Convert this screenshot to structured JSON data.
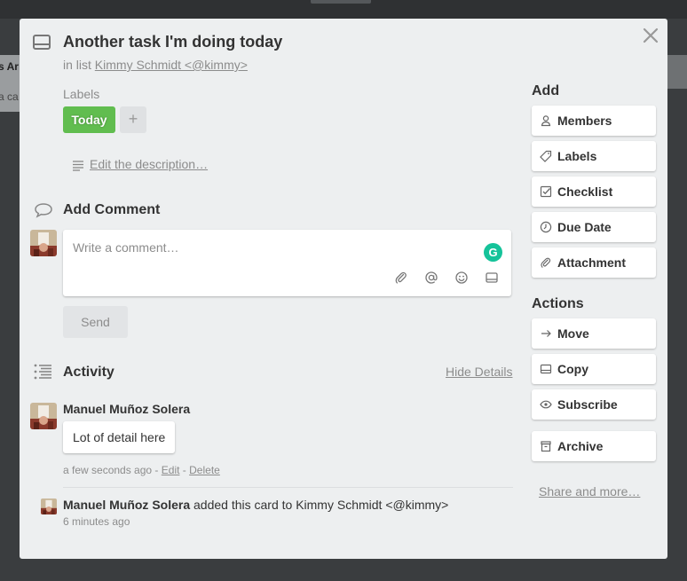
{
  "background": {
    "list_title_fragment": "s Ar",
    "card_fragment": "a ca"
  },
  "card": {
    "title": "Another task I'm doing today",
    "in_list_prefix": "in list",
    "list_name": "Kimmy Schmidt <@kimmy>"
  },
  "labels": {
    "heading": "Labels",
    "items": [
      {
        "name": "Today",
        "color": "#61bd4f"
      }
    ],
    "add_symbol": "+"
  },
  "description": {
    "edit_link": "Edit the description…"
  },
  "comment": {
    "heading": "Add Comment",
    "placeholder": "Write a comment…",
    "send_label": "Send",
    "grammarly_letter": "G",
    "tools": [
      "attachment-icon",
      "mention-icon",
      "emoji-icon",
      "card-icon"
    ]
  },
  "activity": {
    "heading": "Activity",
    "hide_details": "Hide Details",
    "entries": [
      {
        "author": "Manuel Muñoz Solera",
        "comment": "Lot of detail here",
        "time": "a few seconds ago",
        "sep1": "-",
        "edit": "Edit",
        "sep2": "-",
        "delete": "Delete"
      },
      {
        "author": "Manuel Muñoz Solera",
        "action": "added this card to Kimmy Schmidt <@kimmy>",
        "time": "6 minutes ago"
      }
    ]
  },
  "sidebar": {
    "add_heading": "Add",
    "add_buttons": [
      {
        "label": "Members",
        "icon": "person-icon"
      },
      {
        "label": "Labels",
        "icon": "tag-icon"
      },
      {
        "label": "Checklist",
        "icon": "checkbox-icon"
      },
      {
        "label": "Due Date",
        "icon": "clock-icon"
      },
      {
        "label": "Attachment",
        "icon": "paperclip-icon"
      }
    ],
    "actions_heading": "Actions",
    "action_buttons": [
      {
        "label": "Move",
        "icon": "arrow-right-icon"
      },
      {
        "label": "Copy",
        "icon": "card-icon"
      },
      {
        "label": "Subscribe",
        "icon": "eye-icon"
      },
      {
        "label": "Archive",
        "icon": "archive-icon"
      }
    ],
    "share_link": "Share and more…"
  },
  "colors": {
    "modal_bg": "#edeff0",
    "label_green": "#61bd4f",
    "muted_text": "#8c8c8c",
    "grammarly_green": "#15c39a"
  }
}
